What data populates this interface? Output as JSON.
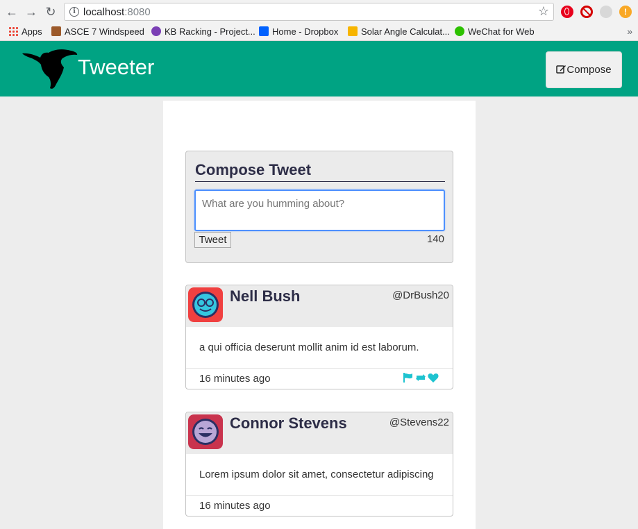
{
  "browser": {
    "url_host": "localhost",
    "url_port": ":8080",
    "bookmarks": [
      {
        "label": "Apps"
      },
      {
        "label": "ASCE 7 Windspeed"
      },
      {
        "label": "KB Racking - Project..."
      },
      {
        "label": "Home - Dropbox"
      },
      {
        "label": "Solar Angle Calculat..."
      },
      {
        "label": "WeChat for Web"
      }
    ],
    "bookmark_more": "»"
  },
  "app": {
    "title": "Tweeter",
    "compose_button_label": "Compose",
    "accent_color": "#00a383"
  },
  "compose": {
    "heading": "Compose Tweet",
    "placeholder": "What are you humming about?",
    "tweet_button_label": "Tweet",
    "counter": "140"
  },
  "tweets": [
    {
      "name": "Nell Bush",
      "handle": "@DrBush20",
      "text": "a qui officia deserunt mollit anim id est laborum.",
      "time": "16 minutes ago",
      "avatar_bg": "#f04040"
    },
    {
      "name": "Connor Stevens",
      "handle": "@Stevens22",
      "text": "Lorem ipsum dolor sit amet, consectetur adipiscing",
      "time": "16 minutes ago",
      "avatar_bg": "#c9334d"
    }
  ]
}
